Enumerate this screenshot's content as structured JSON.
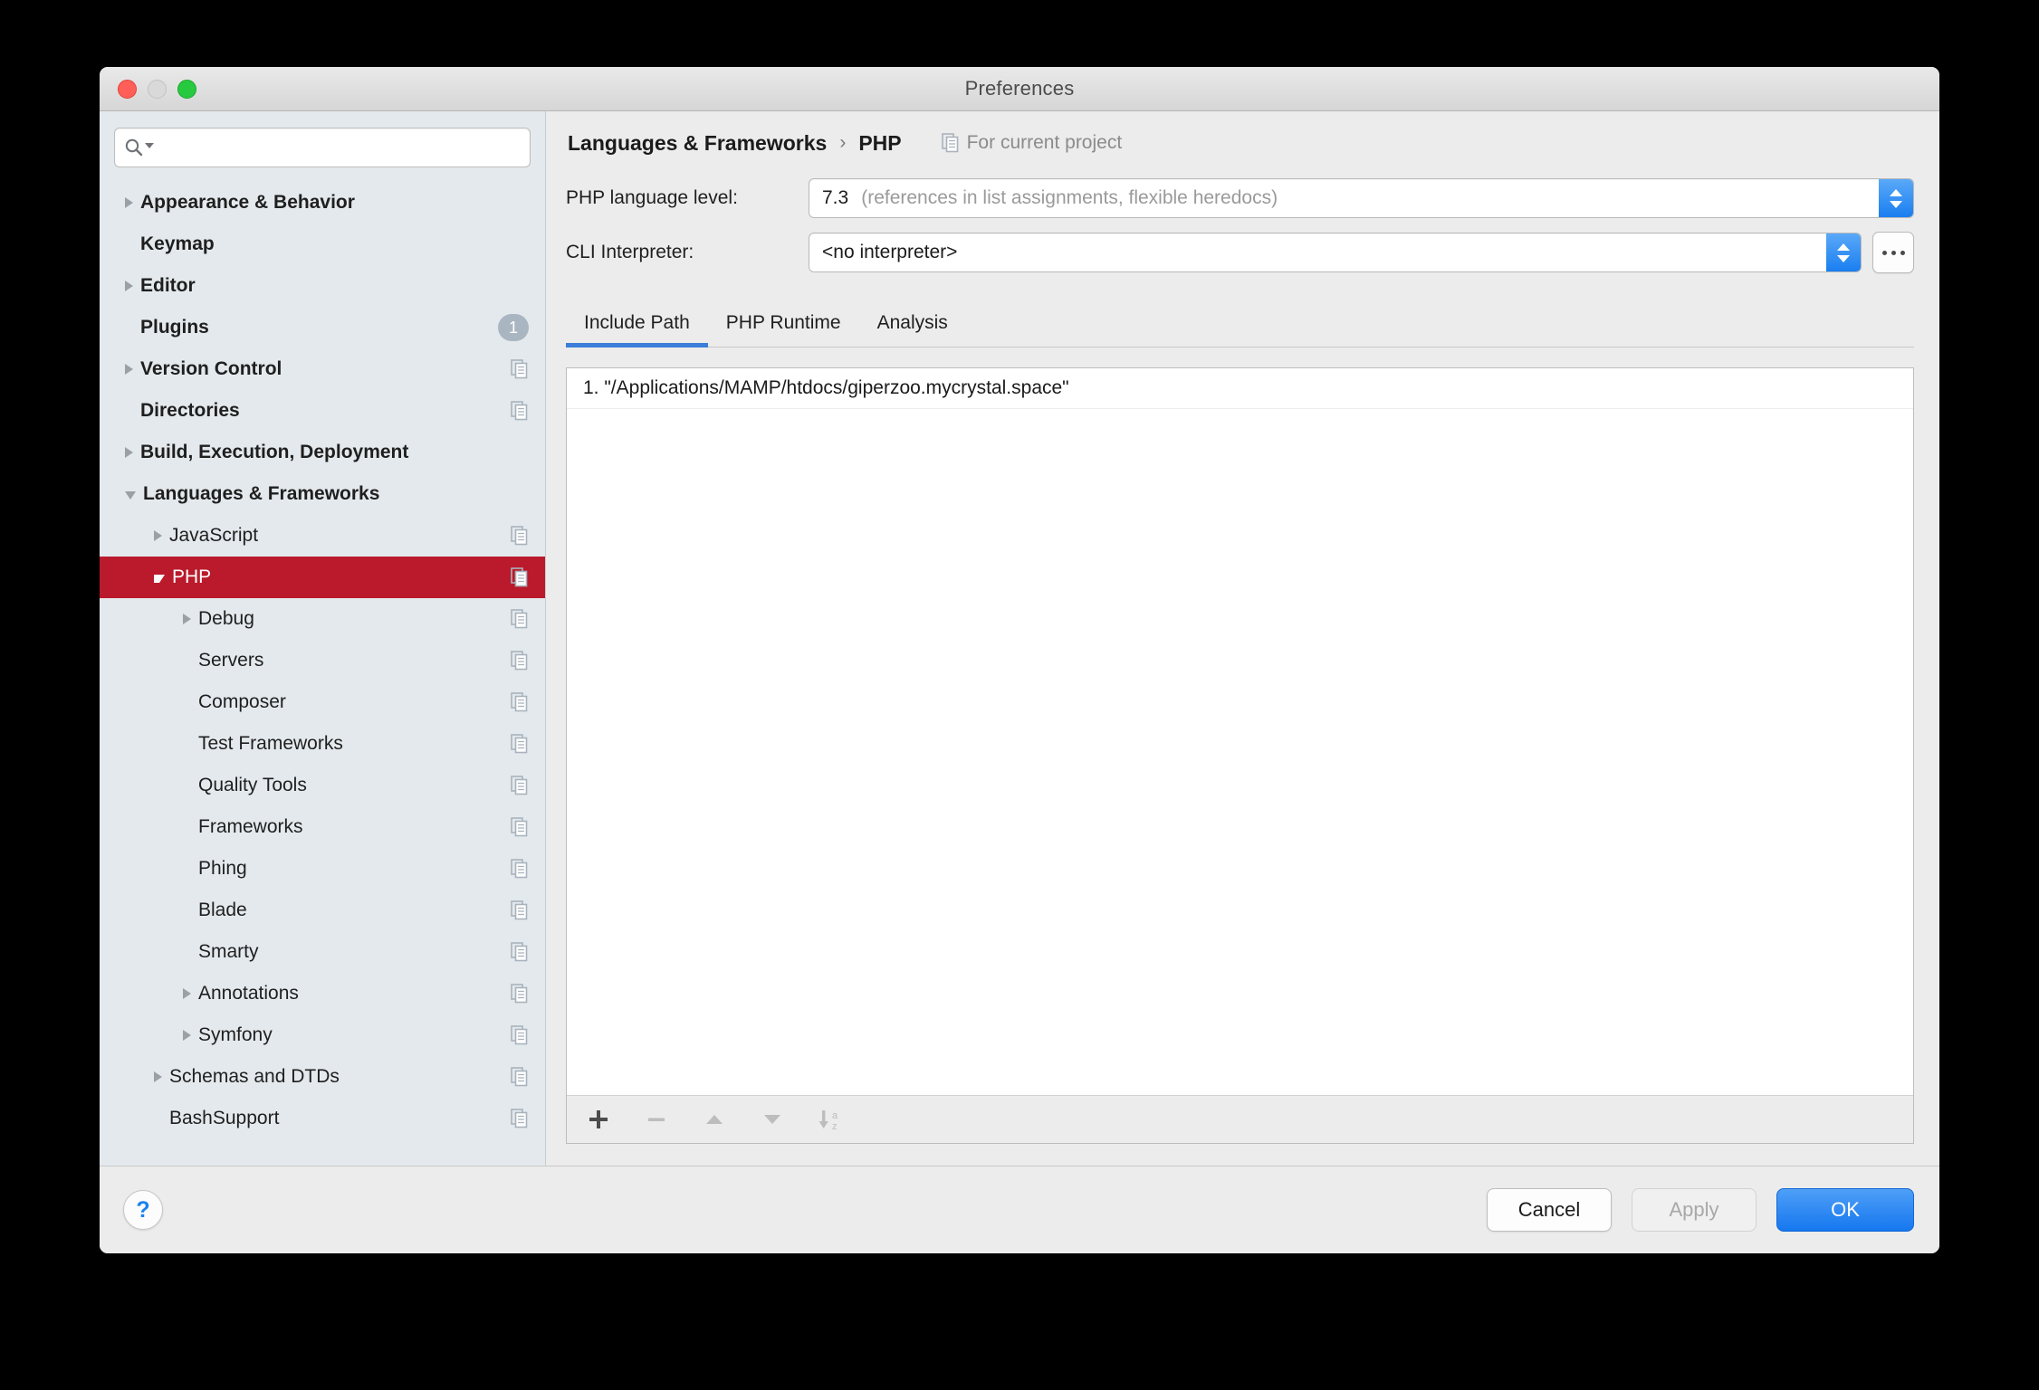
{
  "window": {
    "title": "Preferences",
    "traffic_lights": [
      "close",
      "minimize",
      "zoom"
    ]
  },
  "search": {
    "value": "",
    "placeholder": ""
  },
  "sidebar": {
    "items": [
      {
        "label": "Appearance & Behavior",
        "level": 0,
        "bold": true,
        "arrow": "closed",
        "scope_icon": false,
        "badge": null,
        "selected": false
      },
      {
        "label": "Keymap",
        "level": 0,
        "bold": true,
        "arrow": "none",
        "scope_icon": false,
        "badge": null,
        "selected": false
      },
      {
        "label": "Editor",
        "level": 0,
        "bold": true,
        "arrow": "closed",
        "scope_icon": false,
        "badge": null,
        "selected": false
      },
      {
        "label": "Plugins",
        "level": 0,
        "bold": true,
        "arrow": "none",
        "scope_icon": false,
        "badge": "1",
        "selected": false
      },
      {
        "label": "Version Control",
        "level": 0,
        "bold": true,
        "arrow": "closed",
        "scope_icon": true,
        "badge": null,
        "selected": false
      },
      {
        "label": "Directories",
        "level": 0,
        "bold": true,
        "arrow": "none",
        "scope_icon": true,
        "badge": null,
        "selected": false
      },
      {
        "label": "Build, Execution, Deployment",
        "level": 0,
        "bold": true,
        "arrow": "closed",
        "scope_icon": false,
        "badge": null,
        "selected": false
      },
      {
        "label": "Languages & Frameworks",
        "level": 0,
        "bold": true,
        "arrow": "open",
        "scope_icon": false,
        "badge": null,
        "selected": false
      },
      {
        "label": "JavaScript",
        "level": 1,
        "bold": false,
        "arrow": "closed",
        "scope_icon": true,
        "badge": null,
        "selected": false
      },
      {
        "label": "PHP",
        "level": 1,
        "bold": false,
        "arrow": "open",
        "scope_icon": true,
        "badge": null,
        "selected": true
      },
      {
        "label": "Debug",
        "level": 2,
        "bold": false,
        "arrow": "closed",
        "scope_icon": true,
        "badge": null,
        "selected": false
      },
      {
        "label": "Servers",
        "level": 2,
        "bold": false,
        "arrow": "none",
        "scope_icon": true,
        "badge": null,
        "selected": false
      },
      {
        "label": "Composer",
        "level": 2,
        "bold": false,
        "arrow": "none",
        "scope_icon": true,
        "badge": null,
        "selected": false
      },
      {
        "label": "Test Frameworks",
        "level": 2,
        "bold": false,
        "arrow": "none",
        "scope_icon": true,
        "badge": null,
        "selected": false
      },
      {
        "label": "Quality Tools",
        "level": 2,
        "bold": false,
        "arrow": "none",
        "scope_icon": true,
        "badge": null,
        "selected": false
      },
      {
        "label": "Frameworks",
        "level": 2,
        "bold": false,
        "arrow": "none",
        "scope_icon": true,
        "badge": null,
        "selected": false
      },
      {
        "label": "Phing",
        "level": 2,
        "bold": false,
        "arrow": "none",
        "scope_icon": true,
        "badge": null,
        "selected": false
      },
      {
        "label": "Blade",
        "level": 2,
        "bold": false,
        "arrow": "none",
        "scope_icon": true,
        "badge": null,
        "selected": false
      },
      {
        "label": "Smarty",
        "level": 2,
        "bold": false,
        "arrow": "none",
        "scope_icon": true,
        "badge": null,
        "selected": false
      },
      {
        "label": "Annotations",
        "level": 2,
        "bold": false,
        "arrow": "closed",
        "scope_icon": true,
        "badge": null,
        "selected": false
      },
      {
        "label": "Symfony",
        "level": 2,
        "bold": false,
        "arrow": "closed",
        "scope_icon": true,
        "badge": null,
        "selected": false
      },
      {
        "label": "Schemas and DTDs",
        "level": 1,
        "bold": false,
        "arrow": "closed",
        "scope_icon": true,
        "badge": null,
        "selected": false
      },
      {
        "label": "BashSupport",
        "level": 1,
        "bold": false,
        "arrow": "none",
        "scope_icon": true,
        "badge": null,
        "selected": false
      }
    ]
  },
  "breadcrumb": {
    "parent": "Languages & Frameworks",
    "separator": "›",
    "current": "PHP",
    "scope_label": "For current project"
  },
  "form": {
    "language_level": {
      "label": "PHP language level:",
      "value": "7.3",
      "value_note": "(references in list assignments, flexible heredocs)"
    },
    "cli_interpreter": {
      "label": "CLI Interpreter:",
      "value": "<no interpreter>",
      "browse_label": "..."
    }
  },
  "tabs": [
    {
      "label": "Include Path",
      "active": true
    },
    {
      "label": "PHP Runtime",
      "active": false
    },
    {
      "label": "Analysis",
      "active": false
    }
  ],
  "include_path": {
    "entries": [
      "1. \"/Applications/MAMP/htdocs/giperzoo.mycrystal.space\""
    ],
    "toolbar": [
      {
        "name": "add-button",
        "glyph": "+",
        "enabled": true
      },
      {
        "name": "remove-button",
        "glyph": "−",
        "enabled": false
      },
      {
        "name": "move-up-button",
        "glyph": "▲",
        "enabled": false
      },
      {
        "name": "move-down-button",
        "glyph": "▼",
        "enabled": false
      },
      {
        "name": "sort-alphabetically-button",
        "glyph": "a-z",
        "enabled": false
      }
    ]
  },
  "footer": {
    "help_label": "?",
    "cancel_label": "Cancel",
    "apply_label": "Apply",
    "ok_label": "OK"
  },
  "colors": {
    "selection_red": "#ba1a2b",
    "accent_blue": "#1677ef",
    "tab_underline": "#3b7dd8",
    "sidebar_bg": "#e4e9ed",
    "panel_bg": "#ececec"
  }
}
